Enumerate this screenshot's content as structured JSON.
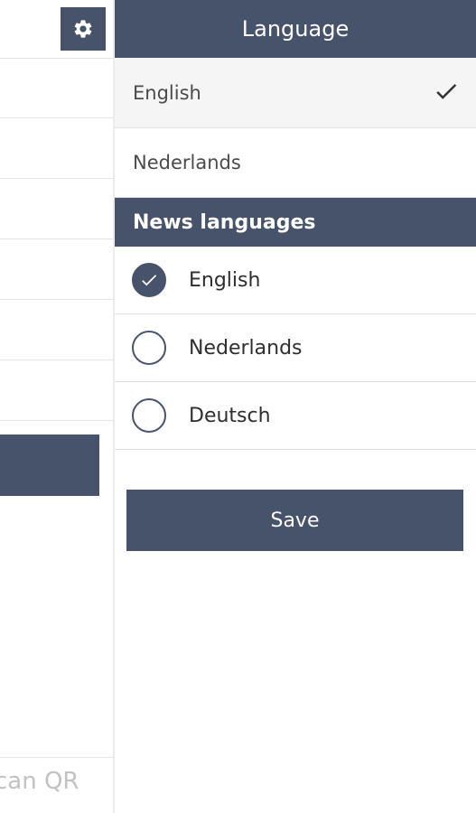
{
  "left": {
    "scan_label": "can QR"
  },
  "header": {
    "title": "Language"
  },
  "languages": [
    {
      "label": "English",
      "selected": true
    },
    {
      "label": "Nederlands",
      "selected": false
    }
  ],
  "news": {
    "title": "News languages",
    "items": [
      {
        "label": "English",
        "checked": true
      },
      {
        "label": "Nederlands",
        "checked": false
      },
      {
        "label": "Deutsch",
        "checked": false
      }
    ]
  },
  "actions": {
    "save_label": "Save"
  },
  "colors": {
    "primary": "#46536b",
    "selected_bg": "#f5f5f5"
  }
}
